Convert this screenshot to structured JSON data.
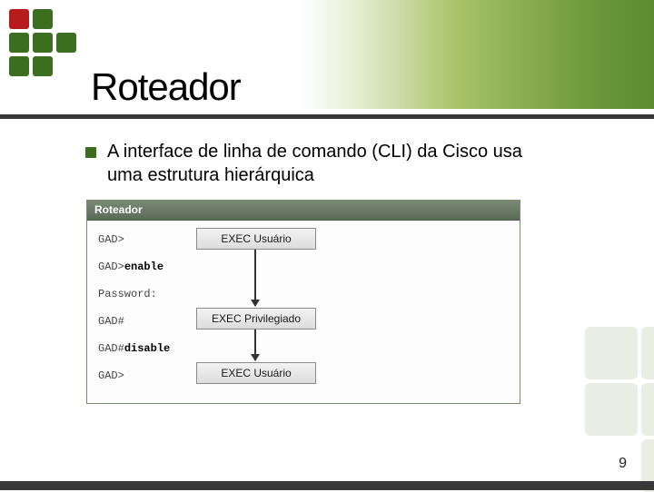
{
  "logo": {
    "colors": {
      "red": "#b71c1c",
      "green": "#3b6e1f",
      "lightgreen": "#7cb342"
    }
  },
  "title": "Roteador",
  "bullet_text": "A interface de linha de comando (CLI) da Cisco usa uma estrutura hierárquica",
  "diagram": {
    "header": "Roteador",
    "rows": [
      {
        "prompt": "GAD>",
        "cmd": ""
      },
      {
        "prompt": "GAD>",
        "cmd": "enable"
      },
      {
        "prompt": "Password:",
        "cmd": ""
      },
      {
        "prompt": "GAD#",
        "cmd": ""
      },
      {
        "prompt": "GAD#",
        "cmd": "disable"
      },
      {
        "prompt": "GAD>",
        "cmd": ""
      }
    ],
    "modes": {
      "user1": "EXEC Usuário",
      "priv": "EXEC Privilegiado",
      "user2": "EXEC Usuário"
    }
  },
  "page_number": "9"
}
